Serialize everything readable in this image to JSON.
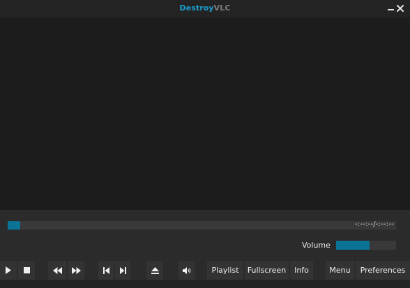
{
  "window": {
    "title_accent": "Destroy",
    "title_rest": "VLC",
    "accent_color": "#1a9fd0"
  },
  "seek": {
    "progress": 0.032,
    "time_display": "-:--:--/-:--:--"
  },
  "volume": {
    "label": "Volume",
    "level": 0.56
  },
  "toolbar": {
    "icons": [
      "play-icon",
      "stop-icon",
      "rewind-icon",
      "fast-forward-icon",
      "previous-icon",
      "next-icon",
      "eject-icon",
      "speaker-icon"
    ],
    "playlist_label": "Playlist",
    "fullscreen_label": "Fullscreen",
    "info_label": "Info",
    "menu_label": "Menu",
    "preferences_label": "Preferences"
  },
  "colors": {
    "progress_fill": "#0a7396",
    "background": "#2b2b2b",
    "video_bg": "#1c1c1c"
  }
}
